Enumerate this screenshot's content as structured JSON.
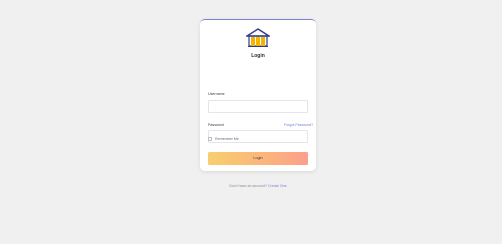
{
  "login": {
    "title": "Login",
    "username_label": "Username",
    "username_value": "",
    "password_label": "Password",
    "password_value": "",
    "forgot_link": "Forgot Password?",
    "remember_label": "Remember Me",
    "submit_label": "Login"
  },
  "footer": {
    "prompt": "Don't have an account?",
    "create_link": "Create One"
  },
  "colors": {
    "accent": "#7b7fd6",
    "button_start": "#f7cf6e",
    "button_end": "#fd9f8c",
    "background": "#f0f0f1"
  },
  "icons": [
    "building-logo"
  ]
}
